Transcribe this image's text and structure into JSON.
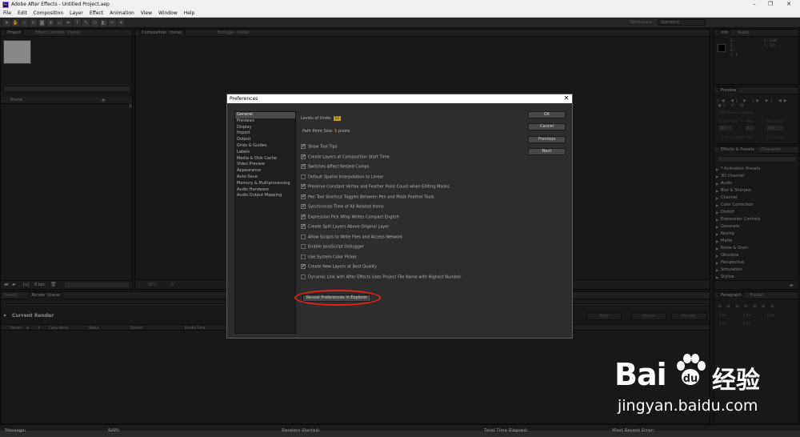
{
  "window": {
    "title": "Adobe After Effects - Untitled Project.aep",
    "app_icon": "Ae"
  },
  "menu": [
    "File",
    "Edit",
    "Composition",
    "Layer",
    "Effect",
    "Animation",
    "View",
    "Window",
    "Help"
  ],
  "workspace": {
    "label": "Workspace:",
    "value": "Standard"
  },
  "left_panel": {
    "tabs": [
      "Project",
      "Effect Controls: (none)"
    ],
    "column_name": "Name",
    "bpc": "8 bpc"
  },
  "comp_panel": {
    "tabs": [
      "Composition: (none)",
      "Footage: (none)"
    ],
    "zoom": "50%"
  },
  "info_panel": {
    "tabs": [
      "Info",
      "Audio"
    ],
    "r": "R :",
    "g": "G :",
    "b": "B :",
    "a": "A : 0",
    "x": "X : 1184",
    "y": "Y : 240"
  },
  "preview_panel": {
    "tab": "Preview",
    "ram_options": "RAM Preview Options",
    "frame_rate": "Frame Rate",
    "skip": "Skip",
    "resolution": "Resolution",
    "auto": "(30)",
    "skip_val": "0",
    "res_val": "Auto",
    "from_current": "From Current Time",
    "full_screen": "Full Screen"
  },
  "effects_panel": {
    "tabs": [
      "Effects & Presets",
      "Character"
    ],
    "items": [
      "* Animation Presets",
      "3D Channel",
      "Audio",
      "Blur & Sharpen",
      "Channel",
      "Color Correction",
      "Distort",
      "Expression Controls",
      "Generate",
      "Keying",
      "Matte",
      "Noise & Grain",
      "Obsolete",
      "Perspective",
      "Simulation",
      "Stylize"
    ]
  },
  "paragraph_panel": {
    "tabs": [
      "Paragraph",
      "Tracker"
    ],
    "values": [
      "0 px",
      "0 px",
      "0 px",
      "0 px",
      "0 px"
    ]
  },
  "render_queue": {
    "tabs": [
      "(none)",
      "Render Queue"
    ],
    "title": "Current Render",
    "columns": [
      "Render",
      "#",
      "Comp Name",
      "Status",
      "Started",
      "Render Time"
    ],
    "buttons": [
      "Stop",
      "Pause",
      "Render"
    ]
  },
  "status_bar": {
    "message": "Message:",
    "ram": "RAM:",
    "renders_started": "Renders Started:",
    "total_time": "Total Time Elapsed:",
    "recent_error": "Most Recent Error:"
  },
  "dialog": {
    "title": "Preferences",
    "categories": [
      "General",
      "Previews",
      "Display",
      "Import",
      "Output",
      "Grids & Guides",
      "Labels",
      "Media & Disk Cache",
      "Video Preview",
      "Appearance",
      "Auto-Save",
      "Memory & Multiprocessing",
      "Audio Hardware",
      "Audio Output Mapping"
    ],
    "selected_category": "General",
    "levels_of_undo_label": "Levels of Undo:",
    "levels_of_undo_value": "32",
    "path_point_label": "Path Point Size:",
    "path_point_value": "5",
    "path_point_unit": "pixels",
    "options": [
      {
        "label": "Show Tool Tips",
        "checked": true
      },
      {
        "label": "Create Layers at Composition Start Time",
        "checked": true
      },
      {
        "label": "Switches Affect Nested Comps",
        "checked": true
      },
      {
        "label": "Default Spatial Interpolation to Linear",
        "checked": false
      },
      {
        "label": "Preserve Constant Vertex and Feather Point Count when Editing Masks",
        "checked": true
      },
      {
        "label": "Pen Tool Shortcut Toggles Between Pen and Mask Feather Tools",
        "checked": true
      },
      {
        "label": "Synchronize Time of All Related Items",
        "checked": true
      },
      {
        "label": "Expression Pick Whip Writes Compact English",
        "checked": true
      },
      {
        "label": "Create Split Layers Above Original Layer",
        "checked": true
      },
      {
        "label": "Allow Scripts to Write Files and Access Network",
        "checked": false
      },
      {
        "label": "Enable JavaScript Debugger",
        "checked": false
      },
      {
        "label": "Use System Color Picker",
        "checked": false
      },
      {
        "label": "Create New Layers at Best Quality",
        "checked": true
      },
      {
        "label": "Dynamic Link with After Effects Uses Project File Name with Highest Number",
        "checked": false
      }
    ],
    "buttons": {
      "ok": "OK",
      "cancel": "Cancel",
      "previous": "Previous",
      "next": "Next"
    },
    "reveal_button": "Reveal Preferences in Explorer",
    "highlight_color": "#e0201b"
  },
  "watermark": {
    "brand_a": "Bai",
    "brand_b": "du",
    "brand_cn": "经验",
    "url": "jingyan.baidu.com"
  }
}
